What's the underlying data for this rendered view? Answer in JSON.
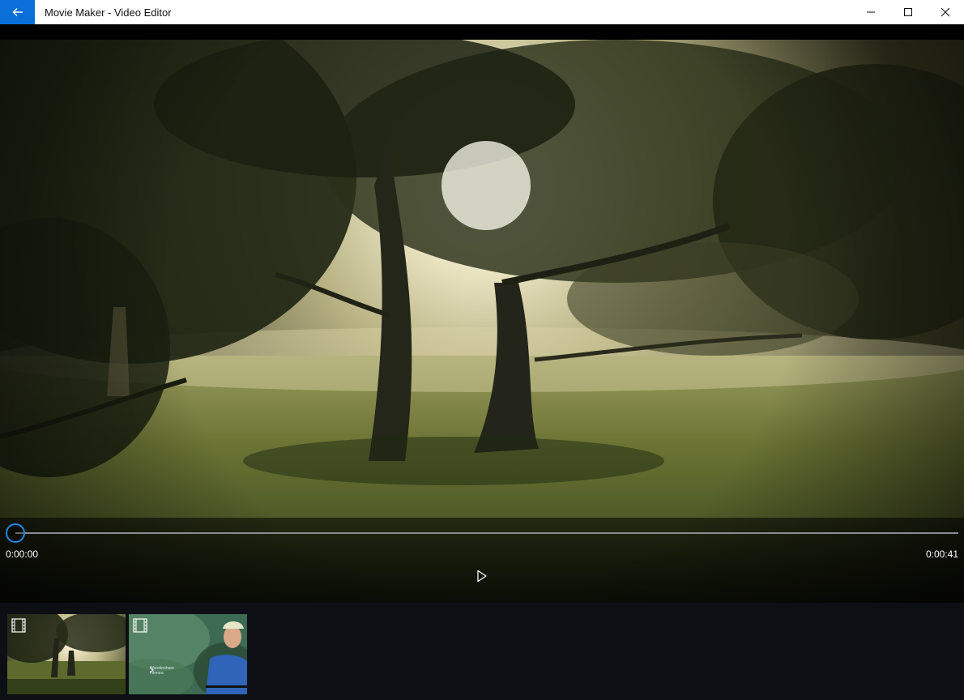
{
  "window": {
    "title": "Movie Maker - Video Editor",
    "back_icon": "back-arrow-icon",
    "controls": [
      "minimize-icon",
      "maximize-icon",
      "close-icon"
    ]
  },
  "player": {
    "time_current": "0:00:00",
    "time_total": "0:00:41",
    "progress_fraction": 0,
    "play_icon": "play-icon",
    "accent_color": "#1e88e5"
  },
  "storyboard": {
    "clips": [
      {
        "thumbnail": "misty-trees-sunrise",
        "badge_icon": "film-strip-icon",
        "caption_line1": "",
        "caption_line2": ""
      },
      {
        "thumbnail": "cyclist-in-forest",
        "badge_icon": "film-strip-icon",
        "caption_line1": "Wondershare",
        "caption_line2": "Filmora"
      }
    ]
  },
  "colors": {
    "titlebar_bg": "#ffffff",
    "back_button_bg": "#0a6fd8",
    "storyboard_bg": "#0d0f14"
  }
}
